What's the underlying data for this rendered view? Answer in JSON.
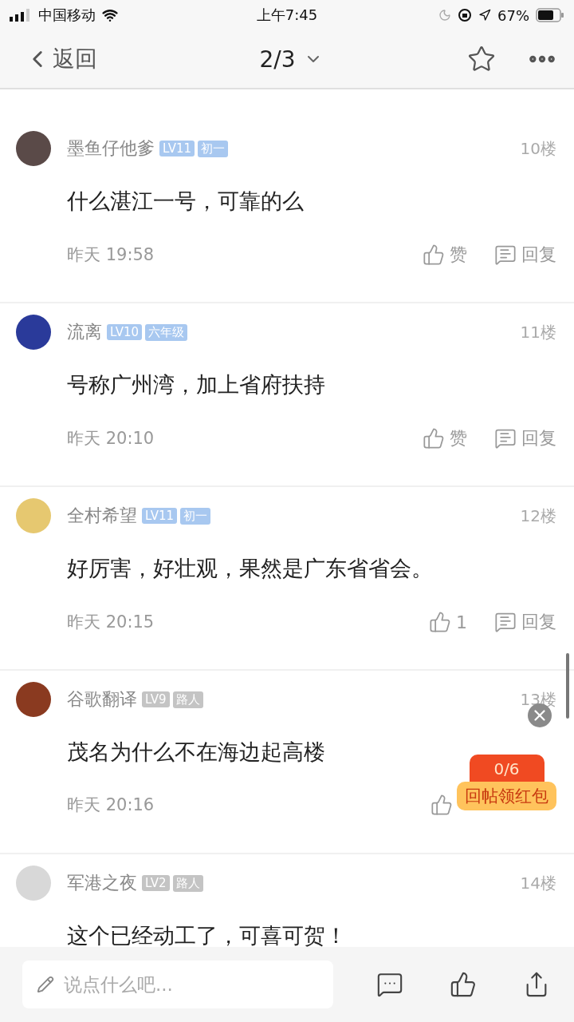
{
  "status_bar": {
    "carrier": "中国移动",
    "time": "上午7:45",
    "battery": "67%"
  },
  "nav": {
    "back": "返回",
    "page": "2/3"
  },
  "comments": [
    {
      "author": "墨鱼仔他爹",
      "level": "LV11",
      "rank": "初一",
      "color": "#a8c8f0",
      "floor": "10楼",
      "text": "什么湛江一号，可靠的么",
      "time": "昨天 19:58",
      "like": "赞",
      "reply": "回复"
    },
    {
      "author": "流离",
      "level": "LV10",
      "rank": "六年级",
      "color": "#a8c8f0",
      "floor": "11楼",
      "text": "号称广州湾，加上省府扶持",
      "time": "昨天 20:10",
      "like": "赞",
      "reply": "回复"
    },
    {
      "author": "全村希望",
      "level": "LV11",
      "rank": "初一",
      "color": "#a8c8f0",
      "floor": "12楼",
      "text": "好厉害，好壮观，果然是广东省省会。",
      "time": "昨天 20:15",
      "like": "1",
      "reply": "回复"
    },
    {
      "author": "谷歌翻译",
      "level": "LV9",
      "rank": "路人",
      "color": "#c4c4c4",
      "floor": "13楼",
      "text": "茂名为什么不在海边起高楼",
      "time": "昨天 20:16"
    },
    {
      "author": "军港之夜",
      "level": "LV2",
      "rank": "路人",
      "color": "#c4c4c4",
      "floor": "14楼",
      "text": "这个已经动工了，可喜可贺！"
    }
  ],
  "red_packet": {
    "progress": "0/6",
    "label": "回帖领红包"
  },
  "composer": {
    "placeholder": "说点什么吧..."
  }
}
